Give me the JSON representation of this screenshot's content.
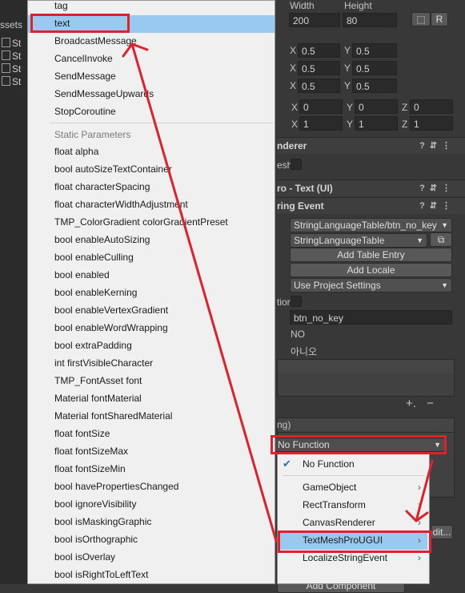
{
  "project_panel": {
    "header": "ssets",
    "assets": [
      "St",
      "St",
      "St",
      "St"
    ]
  },
  "inspector": {
    "width_label": "Width",
    "height_label": "Height",
    "width_value": "200",
    "height_value": "80",
    "r_button": "R",
    "anchors": [
      {
        "x_label": "X",
        "x": "0.5",
        "y_label": "Y",
        "y": "0.5"
      },
      {
        "x_label": "X",
        "x": "0.5",
        "y_label": "Y",
        "y": "0.5"
      },
      {
        "x_label": "X",
        "x": "0.5",
        "y_label": "Y",
        "y": "0.5"
      }
    ],
    "rotation": {
      "x_label": "X",
      "x": "0",
      "y_label": "Y",
      "y": "0",
      "z_label": "Z",
      "z": "0"
    },
    "scale": {
      "x_label": "X",
      "x": "1",
      "y_label": "Y",
      "y": "1",
      "z_label": "Z",
      "z": "1"
    },
    "canvas_renderer_title": "nderer",
    "cull_label": "esh",
    "tmp_title": "ro - Text (UI)",
    "event_title": "ring Event",
    "string_reference": "StringLanguageTable/btn_no_key",
    "table_dropdown": "StringLanguageTable",
    "add_table_entry": "Add Table Entry",
    "add_locale": "Add Locale",
    "locale_override": "Use Project Settings",
    "tion_label": "tion",
    "key_value": "btn_no_key",
    "value_en": "NO",
    "value_ko": "아니오",
    "event_label": "ng)",
    "function_dropdown": "No Function",
    "add_component": "Add Component",
    "edit_button": "dit..."
  },
  "function_menu": {
    "items_top": [
      "tag",
      "text",
      "BroadcastMessage",
      "CancelInvoke",
      "SendMessage",
      "SendMessageUpwards",
      "StopCoroutine"
    ],
    "group_label": "Static Parameters",
    "items_static": [
      "float alpha",
      "bool autoSizeTextContainer",
      "float characterSpacing",
      "float characterWidthAdjustment",
      "TMP_ColorGradient colorGradientPreset",
      "bool enableAutoSizing",
      "bool enableCulling",
      "bool enabled",
      "bool enableKerning",
      "bool enableVertexGradient",
      "bool enableWordWrapping",
      "bool extraPadding",
      "int firstVisibleCharacter",
      "TMP_FontAsset font",
      "Material fontMaterial",
      "Material fontSharedMaterial",
      "float fontSize",
      "float fontSizeMax",
      "float fontSizeMin",
      "bool havePropertiesChanged",
      "bool ignoreVisibility",
      "bool isMaskingGraphic",
      "bool isOrthographic",
      "bool isOverlay",
      "bool isRightToLeftText"
    ]
  },
  "object_menu": {
    "checked_item": "No Function",
    "items": [
      "GameObject",
      "RectTransform",
      "CanvasRenderer",
      "TextMeshProUGUI",
      "LocalizeStringEvent"
    ]
  },
  "colors": {
    "highlight": "#e0202a",
    "selection": "#99c9ef"
  }
}
